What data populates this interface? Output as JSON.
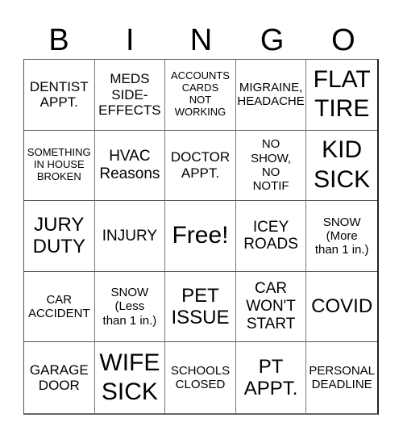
{
  "header": {
    "letters": [
      "B",
      "I",
      "N",
      "G",
      "O"
    ]
  },
  "cells": [
    {
      "text": "DENTIST\nAPPT.",
      "size": "md"
    },
    {
      "text": "MEDS\nSIDE-\nEFFECTS",
      "size": "md"
    },
    {
      "text": "ACCOUNTS\nCARDS\nNOT\nWORKING",
      "size": "xs"
    },
    {
      "text": "MIGRAINE,\nHEADACHE",
      "size": "sm"
    },
    {
      "text": "FLAT\nTIRE",
      "size": "xxl"
    },
    {
      "text": "SOMETHING\nIN HOUSE\nBROKEN",
      "size": "xs"
    },
    {
      "text": "HVAC\nReasons",
      "size": "lg"
    },
    {
      "text": "DOCTOR\nAPPT.",
      "size": "md"
    },
    {
      "text": "NO\nSHOW,\nNO\nNOTIF",
      "size": "sm"
    },
    {
      "text": "KID\nSICK",
      "size": "xxl"
    },
    {
      "text": "JURY\nDUTY",
      "size": "xl"
    },
    {
      "text": "INJURY",
      "size": "lg"
    },
    {
      "text": "Free!",
      "size": "xxl"
    },
    {
      "text": "ICEY\nROADS",
      "size": "lg"
    },
    {
      "text": "SNOW\n(More\nthan 1 in.)",
      "size": "sm"
    },
    {
      "text": "CAR\nACCIDENT",
      "size": "sm"
    },
    {
      "text": "SNOW\n(Less\nthan 1 in.)",
      "size": "sm"
    },
    {
      "text": "PET\nISSUE",
      "size": "xl"
    },
    {
      "text": "CAR\nWON'T\nSTART",
      "size": "lg"
    },
    {
      "text": "COVID",
      "size": "xl"
    },
    {
      "text": "GARAGE\nDOOR",
      "size": "md"
    },
    {
      "text": "WIFE\nSICK",
      "size": "xxl"
    },
    {
      "text": "SCHOOLS\nCLOSED",
      "size": "sm"
    },
    {
      "text": "PT\nAPPT.",
      "size": "xl"
    },
    {
      "text": "PERSONAL\nDEADLINE",
      "size": "sm"
    }
  ]
}
